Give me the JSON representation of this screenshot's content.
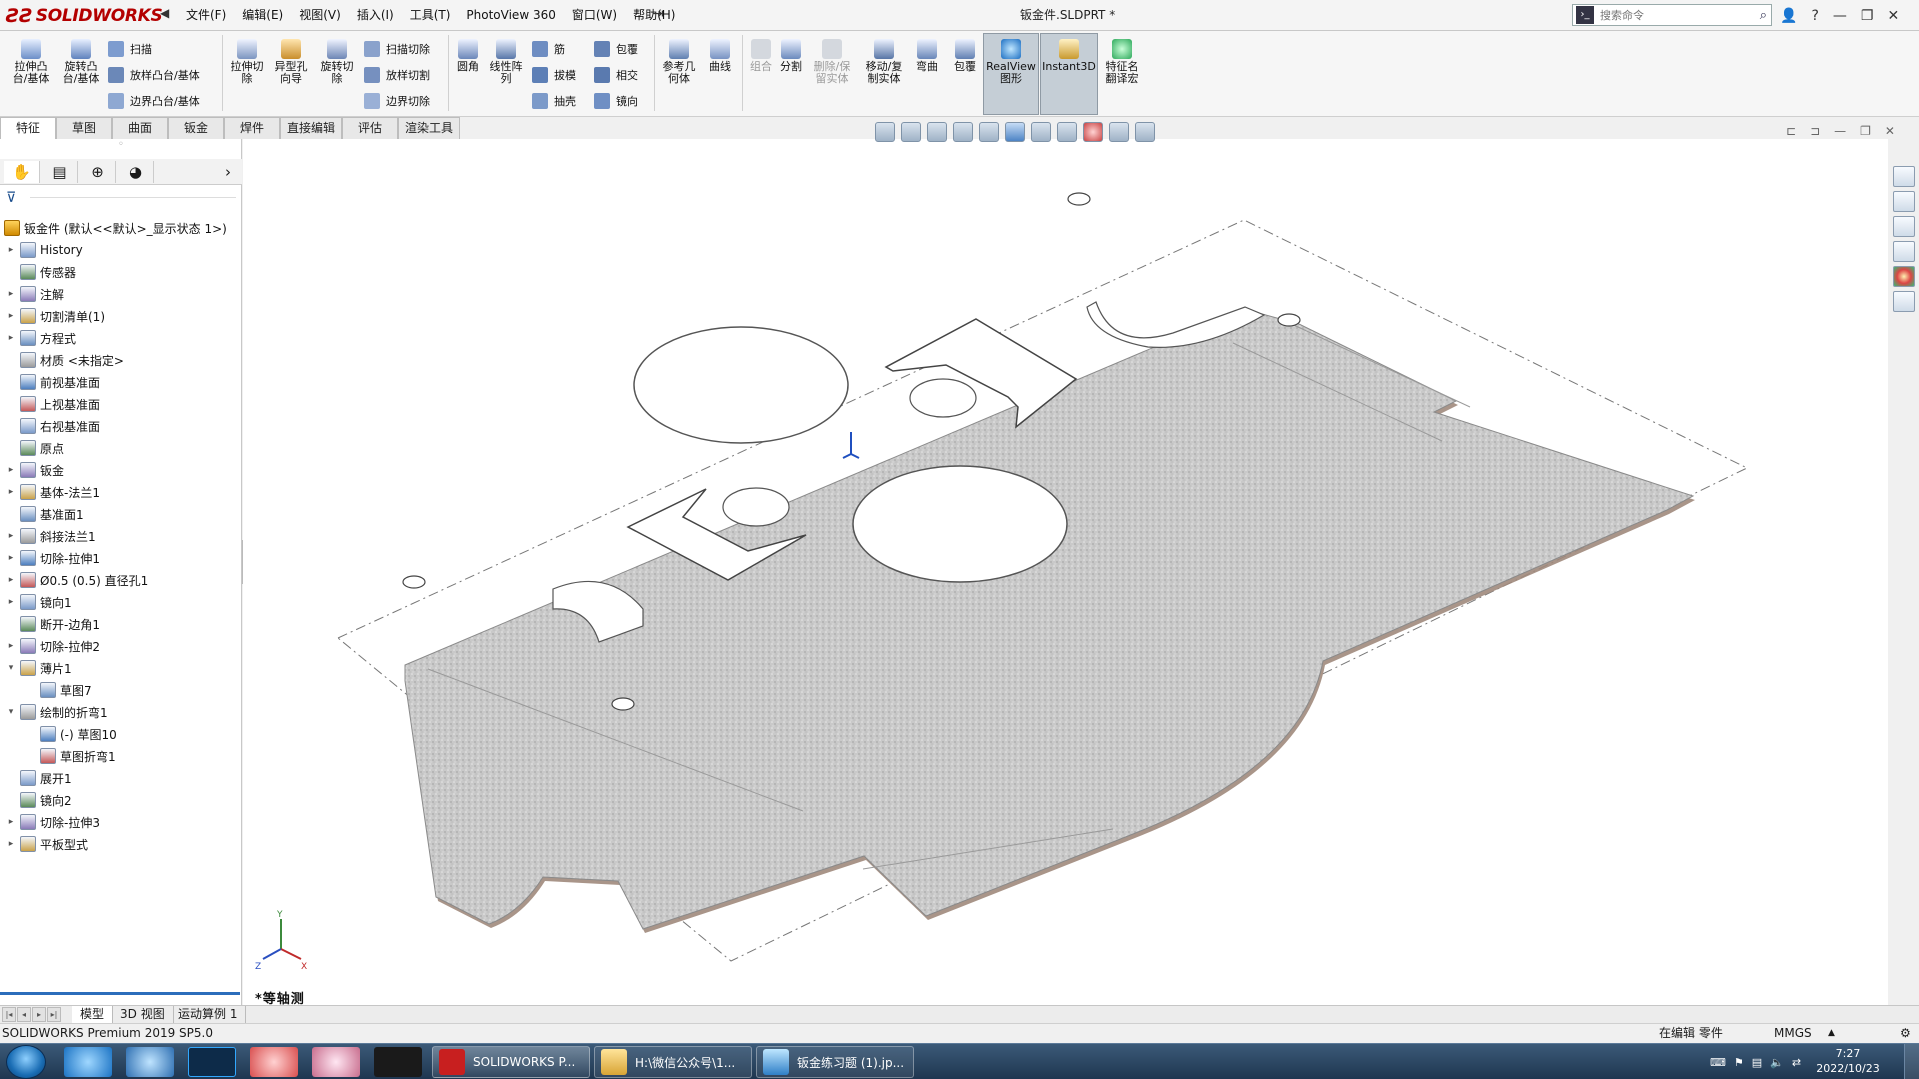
{
  "titlebar": {
    "brand": "SOLIDWORKS",
    "menus": [
      "文件(F)",
      "编辑(E)",
      "视图(V)",
      "插入(I)",
      "工具(T)",
      "PhotoView 360",
      "窗口(W)",
      "帮助(H)"
    ],
    "doc_title": "钣金件.SLDPRT *",
    "search_placeholder": "搜索命令",
    "help_label": "?",
    "window_controls": [
      "minimize-icon",
      "restore-icon",
      "close-icon"
    ]
  },
  "commands": {
    "extrude_boss": "拉伸凸\n台/基体",
    "revolve_boss": "旋转凸\n台/基体",
    "sweep": "扫描",
    "loft": "放样凸台/基体",
    "boundary": "边界凸台/基体",
    "extrude_cut": "拉伸切\n除",
    "hole_wizard": "异型孔\n向导",
    "revolve_cut": "旋转切\n除",
    "swept_cut": "扫描切除",
    "lofted_cut": "放样切割",
    "boundary_cut": "边界切除",
    "fillet": "圆角",
    "linear_pattern": "线性阵\n列",
    "rib": "筋",
    "draft": "拔模",
    "shell": "抽壳",
    "wrap": "包覆",
    "intersect": "相交",
    "mirror": "镜向",
    "ref_geometry": "参考几\n何体",
    "curves": "曲线",
    "combine": "组合",
    "split": "分割",
    "delete_keep_body": "删除/保\n留实体",
    "move_copy": "移动/复\n制实体",
    "flex": "弯曲",
    "wrap2": "包覆",
    "realview": "RealView\n图形",
    "instant3d": "Instant3D",
    "feature_translate": "特征名\n翻译宏"
  },
  "tabs": [
    "特征",
    "草图",
    "曲面",
    "钣金",
    "焊件",
    "直接编辑",
    "评估",
    "渲染工具"
  ],
  "active_tab": "特征",
  "feature_tree": {
    "root": "钣金件  (默认<<默认>_显示状态 1>)",
    "nodes": [
      {
        "label": "History",
        "arrow": "▸",
        "indent": 0
      },
      {
        "label": "传感器",
        "arrow": "",
        "indent": 0
      },
      {
        "label": "注解",
        "arrow": "▸",
        "indent": 0
      },
      {
        "label": "切割清单(1)",
        "arrow": "▸",
        "indent": 0
      },
      {
        "label": "方程式",
        "arrow": "▸",
        "indent": 0
      },
      {
        "label": "材质 <未指定>",
        "arrow": "",
        "indent": 0
      },
      {
        "label": "前视基准面",
        "arrow": "",
        "indent": 0
      },
      {
        "label": "上视基准面",
        "arrow": "",
        "indent": 0
      },
      {
        "label": "右视基准面",
        "arrow": "",
        "indent": 0
      },
      {
        "label": "原点",
        "arrow": "",
        "indent": 0
      },
      {
        "label": "钣金",
        "arrow": "▸",
        "indent": 0
      },
      {
        "label": "基体-法兰1",
        "arrow": "▸",
        "indent": 0
      },
      {
        "label": "基准面1",
        "arrow": "",
        "indent": 0
      },
      {
        "label": "斜接法兰1",
        "arrow": "▸",
        "indent": 0
      },
      {
        "label": "切除-拉伸1",
        "arrow": "▸",
        "indent": 0
      },
      {
        "label": "Ø0.5 (0.5) 直径孔1",
        "arrow": "▸",
        "indent": 0
      },
      {
        "label": "镜向1",
        "arrow": "▸",
        "indent": 0
      },
      {
        "label": "断开-边角1",
        "arrow": "",
        "indent": 0
      },
      {
        "label": "切除-拉伸2",
        "arrow": "▸",
        "indent": 0
      },
      {
        "label": "薄片1",
        "arrow": "▾",
        "indent": 0
      },
      {
        "label": "草图7",
        "arrow": "",
        "indent": 1
      },
      {
        "label": "绘制的折弯1",
        "arrow": "▾",
        "indent": 0
      },
      {
        "label": "(-) 草图10",
        "arrow": "",
        "indent": 1
      },
      {
        "label": "草图折弯1",
        "arrow": "",
        "indent": 1
      },
      {
        "label": "展开1",
        "arrow": "",
        "indent": 0
      },
      {
        "label": "镜向2",
        "arrow": "",
        "indent": 0
      },
      {
        "label": "切除-拉伸3",
        "arrow": "▸",
        "indent": 0
      },
      {
        "label": "平板型式",
        "arrow": "▸",
        "indent": 0
      }
    ]
  },
  "viewport": {
    "view_label": "*等轴测",
    "triad_axes": [
      "Y",
      "X",
      "Z"
    ]
  },
  "bottom_tabs": [
    "模型",
    "3D 视图",
    "运动算例 1"
  ],
  "status": {
    "product": "SOLIDWORKS Premium 2019 SP5.0",
    "mode": "在编辑 零件",
    "units": "MMGS"
  },
  "taskbar": {
    "apps": [
      "SOLIDWORKS P...",
      "H:\\微信公众号\\1...",
      "钣金练习题 (1).jp..."
    ],
    "sw_year": "2019",
    "time": "7:27",
    "date": "2022/10/23"
  },
  "colors": {
    "brand_red": "#b30000",
    "sheet_gray": "#c9c9c9",
    "taskbar_blue": "#2a4765",
    "tree_accent": "#2b6dbb"
  }
}
